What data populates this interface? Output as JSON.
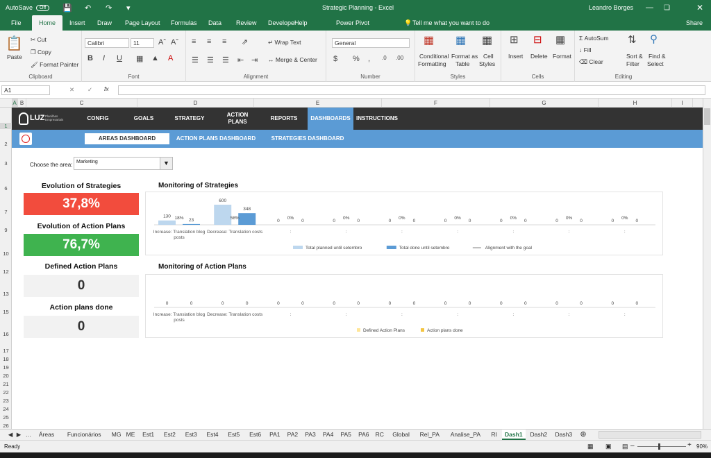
{
  "titlebar": {
    "autosave": "AutoSave",
    "autosave_state": "Off",
    "title": "Strategic Planning  -  Excel",
    "user": "Leandro Borges"
  },
  "ribbon_tabs": [
    "File",
    "Home",
    "Insert",
    "Draw",
    "Page Layout",
    "Formulas",
    "Data",
    "Review",
    "Developer",
    "Help",
    "Power Pivot"
  ],
  "tell_me": "Tell me what you want to do",
  "share": "Share",
  "clipboard": {
    "paste": "Paste",
    "cut": "Cut",
    "copy": "Copy",
    "format_painter": "Format Painter",
    "label": "Clipboard"
  },
  "font": {
    "name": "Calibri",
    "size": "11",
    "label": "Font"
  },
  "alignment": {
    "wrap": "Wrap Text",
    "merge": "Merge & Center",
    "label": "Alignment"
  },
  "number": {
    "format": "General",
    "label": "Number"
  },
  "styles": {
    "conditional": "Conditional",
    "conditional2": "Formatting",
    "format_as": "Format as",
    "format_as2": "Table",
    "cell": "Cell",
    "cell2": "Styles",
    "label": "Styles"
  },
  "cells": {
    "insert": "Insert",
    "delete": "Delete",
    "format": "Format",
    "label": "Cells"
  },
  "editing": {
    "autosum": "AutoSum",
    "fill": "Fill",
    "clear": "Clear",
    "sort": "Sort &",
    "sort2": "Filter",
    "find": "Find &",
    "find2": "Select",
    "label": "Editing"
  },
  "namebox": "A1",
  "fx": "fx",
  "columns": [
    "A",
    "B",
    "C",
    "D",
    "E",
    "F",
    "G",
    "H",
    "I"
  ],
  "rows": [
    "1",
    "2",
    "3",
    "6",
    "7",
    "9",
    "10",
    "12",
    "13",
    "15",
    "16",
    "17",
    "18",
    "19",
    "20",
    "21",
    "22",
    "23",
    "24",
    "25",
    "26",
    "27",
    "28",
    "29"
  ],
  "nav": {
    "logo": "LUZ",
    "logo_sub": "Planilhas Empresariais",
    "items": [
      "CONFIG",
      "GOALS",
      "STRATEGY",
      "ACTION PLANS",
      "REPORTS",
      "DASHBOARDS",
      "INSTRUCTIONS"
    ]
  },
  "subnav": [
    "AREAS DASHBOARD",
    "ACTION PLANS DASHBOARD",
    "STRATEGIES DASHBOARD"
  ],
  "area": {
    "label": "Choose the area:",
    "value": "Marketing"
  },
  "kpis": [
    {
      "title": "Evolution of Strategies",
      "value": "37,8%",
      "color": "#f24c3d"
    },
    {
      "title": "Evolution of Action Plans",
      "value": "76,7%",
      "color": "#3fb34f"
    },
    {
      "title": "Defined Action Plans",
      "value": "0",
      "color": "#f2f2f2"
    },
    {
      "title": "Action plans done",
      "value": "0",
      "color": "#f2f2f2"
    }
  ],
  "chart_data": [
    {
      "type": "bar",
      "title": "Monitoring of Strategies",
      "categories": [
        "Increase: Translation blog posts",
        "Decrease: Translation costs",
        ":",
        ":",
        ":",
        ":",
        ":",
        ":",
        ":"
      ],
      "series": [
        {
          "name": "Total planned until setembro",
          "values": [
            130,
            600,
            0,
            0,
            0,
            0,
            0,
            0,
            0
          ],
          "color": "#bdd7ee"
        },
        {
          "name": "Total done until setembro",
          "values": [
            23,
            348,
            0,
            0,
            0,
            0,
            0,
            0,
            0
          ],
          "color": "#5b9bd5"
        },
        {
          "name": "Alignment with the goal",
          "values": [
            "18%",
            "58%",
            "0%",
            "0%",
            "0%",
            "0%",
            "0%",
            "0%",
            "0%"
          ],
          "color": "#808080"
        }
      ],
      "ylim": [
        0,
        620
      ]
    },
    {
      "type": "bar",
      "title": "Monitoring of Action Plans",
      "categories": [
        "Increase: Translation blog posts",
        "Decrease: Translation costs",
        ":",
        ":",
        ":",
        ":",
        ":",
        ":",
        ":"
      ],
      "series": [
        {
          "name": "Defined Action Plans",
          "values": [
            0,
            0,
            0,
            0,
            0,
            0,
            0,
            0,
            0
          ],
          "color": "#ffe699"
        },
        {
          "name": "Action plans done",
          "values": [
            0,
            0,
            0,
            0,
            0,
            0,
            0,
            0,
            0
          ],
          "color": "#f4c542"
        }
      ]
    }
  ],
  "sheet_tabs": [
    "Áreas",
    "Funcionários",
    "MG",
    "ME",
    "Est1",
    "Est2",
    "Est3",
    "Est4",
    "Est5",
    "Est6",
    "PA1",
    "PA2",
    "PA3",
    "PA4",
    "PA5",
    "PA6",
    "RC",
    "Global",
    "Rel_PA",
    "Analise_PA",
    "RI",
    "Dash1",
    "Dash2",
    "Dash3",
    "INI",
    "DU'"
  ],
  "active_sheet": "Dash1",
  "status": {
    "ready": "Ready",
    "zoom": "90%"
  }
}
